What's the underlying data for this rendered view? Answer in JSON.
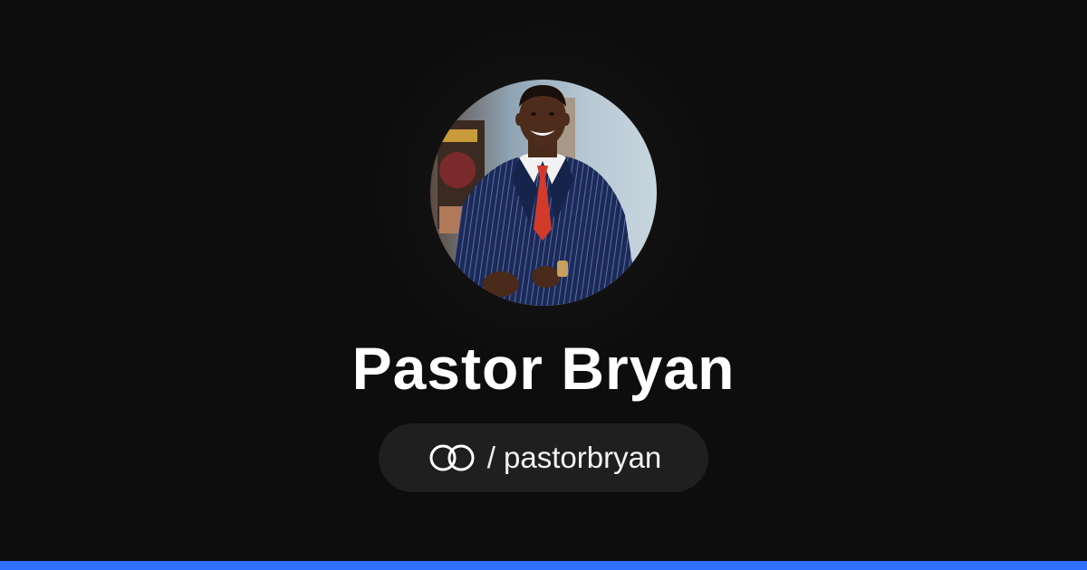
{
  "profile": {
    "name": "Pastor Bryan",
    "handle": "/ pastorbryan",
    "avatar": "portrait-photo"
  },
  "logo": {
    "icon": "interlinked-rings-icon"
  },
  "colors": {
    "background": "#0d0d0d",
    "pill_background": "#1f1f1f",
    "text": "#ffffff",
    "accent_bar": "#2f6fff"
  }
}
